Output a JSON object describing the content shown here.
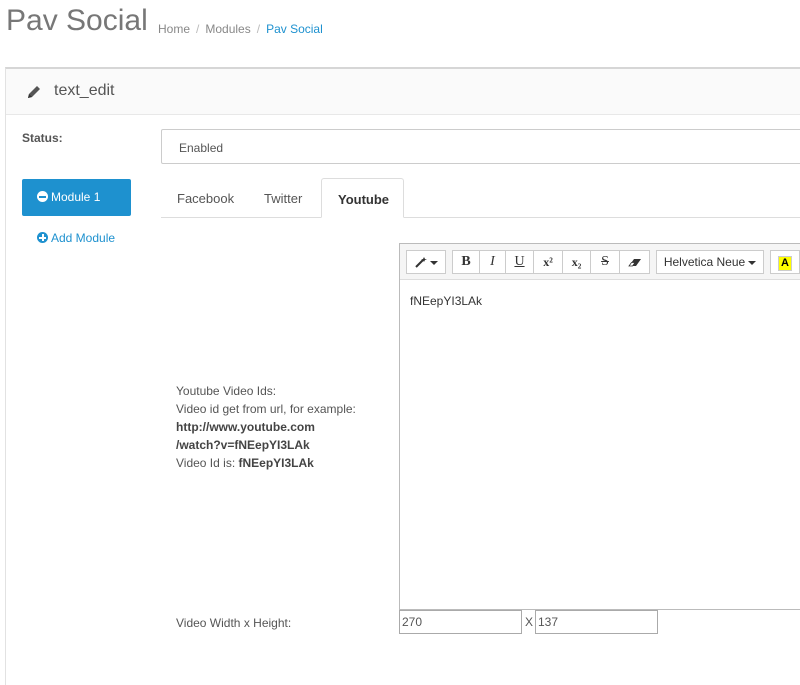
{
  "header": {
    "title": "Pav Social",
    "breadcrumb": [
      "Home",
      "Modules",
      "Pav Social"
    ],
    "breadcrumb_sep": "/"
  },
  "panel": {
    "title": "text_edit",
    "icon": "pencil-icon"
  },
  "status": {
    "label": "Status:",
    "value": "Enabled"
  },
  "modules": {
    "items": [
      "Module 1"
    ],
    "add_label": "Add Module"
  },
  "tabs": [
    "Facebook",
    "Twitter",
    "Youtube"
  ],
  "active_tab": "Youtube",
  "help": {
    "line1": "Youtube Video Ids:",
    "line2": "Video id get from url, for example:",
    "url1": "http://www.youtube.com",
    "url2": "/watch?v=fNEepYI3LAk",
    "id_prefix": "Video Id is: ",
    "id_value": "fNEepYI3LAk"
  },
  "editor": {
    "toolbar": {
      "magic": "magic-wand-icon",
      "bold": "B",
      "italic": "I",
      "underline": "U",
      "superscript": "x²",
      "subscript": "x₂",
      "strike": "S",
      "eraser": "eraser-icon",
      "font": "Helvetica Neue",
      "highlight": "A"
    },
    "content": "fNEepYI3LAk"
  },
  "size": {
    "label": "Video Width x Height:",
    "width": "270",
    "separator": "X",
    "height": "137"
  },
  "colors": {
    "accent": "#1e91cf",
    "border": "#cccccc"
  }
}
